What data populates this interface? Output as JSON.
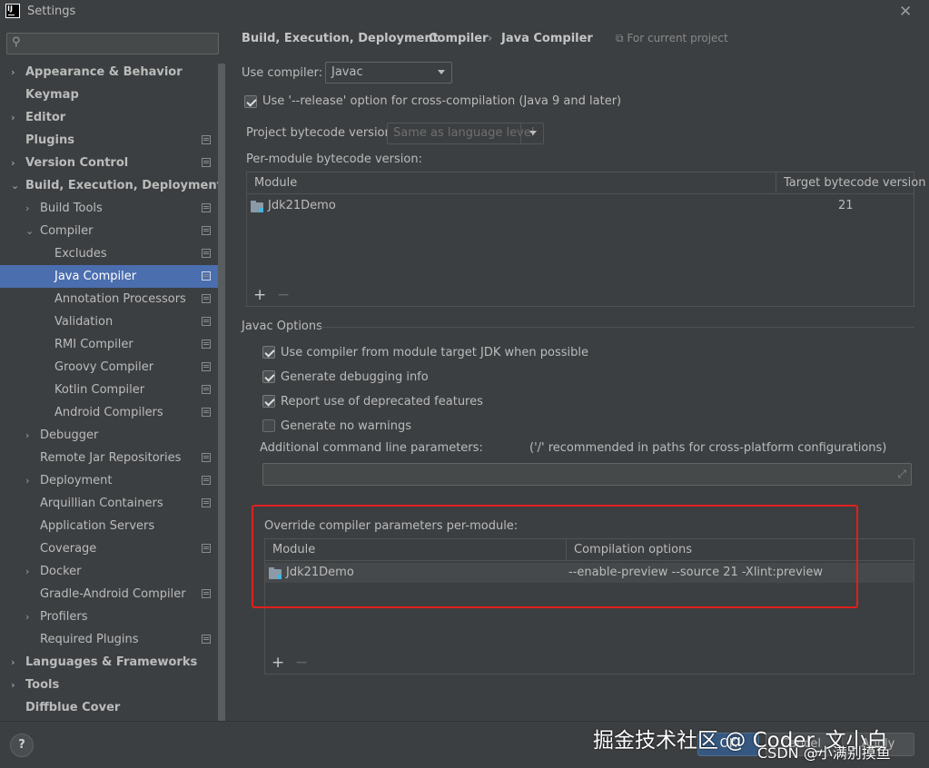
{
  "window": {
    "title": "Settings",
    "logo_text": "IJ"
  },
  "search": {
    "placeholder": ""
  },
  "sidebar": {
    "items": [
      {
        "label": "Appearance & Behavior",
        "arrow": "›",
        "bold": true
      },
      {
        "label": "Keymap",
        "bold": true
      },
      {
        "label": "Editor",
        "arrow": "›",
        "bold": true
      },
      {
        "label": "Plugins",
        "bold": true,
        "proj": true
      },
      {
        "label": "Version Control",
        "arrow": "›",
        "bold": true,
        "proj": true
      },
      {
        "label": "Build, Execution, Deployment",
        "arrow": "⌄",
        "bold": true
      },
      {
        "label": "Build Tools",
        "arrow": "›",
        "proj": true
      },
      {
        "label": "Compiler",
        "arrow": "⌄",
        "proj": true
      },
      {
        "label": "Excludes",
        "proj": true
      },
      {
        "label": "Java Compiler",
        "proj": true,
        "selected": true
      },
      {
        "label": "Annotation Processors",
        "proj": true
      },
      {
        "label": "Validation",
        "proj": true
      },
      {
        "label": "RMI Compiler",
        "proj": true
      },
      {
        "label": "Groovy Compiler",
        "proj": true
      },
      {
        "label": "Kotlin Compiler",
        "proj": true
      },
      {
        "label": "Android Compilers",
        "proj": true
      },
      {
        "label": "Debugger",
        "arrow": "›"
      },
      {
        "label": "Remote Jar Repositories",
        "proj": true
      },
      {
        "label": "Deployment",
        "arrow": "›",
        "proj": true
      },
      {
        "label": "Arquillian Containers",
        "proj": true
      },
      {
        "label": "Application Servers"
      },
      {
        "label": "Coverage",
        "proj": true
      },
      {
        "label": "Docker",
        "arrow": "›"
      },
      {
        "label": "Gradle-Android Compiler",
        "proj": true
      },
      {
        "label": "Profilers",
        "arrow": "›"
      },
      {
        "label": "Required Plugins",
        "proj": true
      },
      {
        "label": "Languages & Frameworks",
        "arrow": "›",
        "bold": true
      },
      {
        "label": "Tools",
        "arrow": "›",
        "bold": true
      },
      {
        "label": "Diffblue Cover",
        "bold": true
      }
    ]
  },
  "breadcrumb": {
    "parts": [
      "Build, Execution, Deployment",
      "Compiler",
      "Java Compiler"
    ],
    "separator": "›",
    "scope": "For current project"
  },
  "compiler": {
    "use_compiler_label": "Use compiler:",
    "use_compiler_value": "Javac",
    "release_option_label": "Use '--release' option for cross-compilation (Java 9 and later)",
    "release_option_checked": true,
    "bytecode_label": "Project bytecode version:",
    "bytecode_value": "Same as language level",
    "per_module_label": "Per-module bytecode version:"
  },
  "bytecode_table": {
    "columns": [
      "Module",
      "Target bytecode version"
    ],
    "rows": [
      {
        "module": "Jdk21Demo",
        "target": "21"
      }
    ]
  },
  "javac_options": {
    "title": "Javac Options",
    "checkboxes": [
      {
        "label": "Use compiler from module target JDK when possible",
        "checked": true
      },
      {
        "label": "Generate debugging info",
        "checked": true
      },
      {
        "label": "Report use of deprecated features",
        "checked": true
      },
      {
        "label": "Generate no warnings",
        "checked": false
      }
    ],
    "additional_label": "Additional command line parameters:",
    "additional_hint": "('/' recommended in paths for cross-platform configurations)",
    "additional_value": ""
  },
  "override": {
    "label": "Override compiler parameters per-module:",
    "columns": [
      "Module",
      "Compilation options"
    ],
    "rows": [
      {
        "module": "Jdk21Demo",
        "options": "--enable-preview --source 21 -Xlint:preview"
      }
    ]
  },
  "table_toolbar": {
    "add": "+",
    "remove": "−"
  },
  "buttons": {
    "help": "?",
    "ok": "OK",
    "cancel": "Cancel",
    "apply": "Apply"
  },
  "watermark": {
    "line1": "掘金技术社区 @ Coder_文小白",
    "line2": "CSDN @小满别摸鱼"
  },
  "colors": {
    "background": "#3c3f41",
    "selection": "#4b6eaf",
    "highlight_box": "#e0201d",
    "module_icon_accent": "#40b6e0"
  }
}
